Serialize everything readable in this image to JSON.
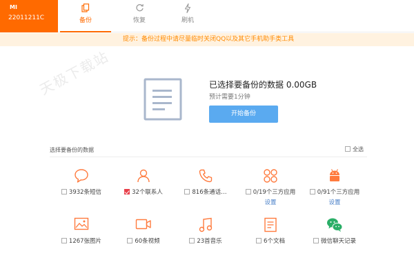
{
  "device": {
    "logo": "MI",
    "model": "22011211C"
  },
  "tabs": [
    {
      "label": "备份",
      "icon": "backup-icon",
      "active": true
    },
    {
      "label": "恢复",
      "icon": "restore-icon",
      "active": false
    },
    {
      "label": "刷机",
      "icon": "flash-icon",
      "active": false
    }
  ],
  "tip": "提示：备份过程中请尽量临时关闭QQ以及其它手机助手类工具",
  "watermark": "天极下载站",
  "summary": {
    "title": "已选择要备份的数据 0.00GB",
    "subtitle": "预计需要1分钟",
    "start_button": "开始备份"
  },
  "section_label": "选择要备份的数据",
  "select_all": "全选",
  "items": [
    {
      "icon": "sms-icon",
      "label": "3932条短信",
      "checked": false
    },
    {
      "icon": "contacts-icon",
      "label": "32个联系人",
      "checked": true
    },
    {
      "icon": "call-log-icon",
      "label": "816条通话…",
      "checked": false
    },
    {
      "icon": "apps-icon",
      "label": "0/19个三方应用",
      "checked": false,
      "link": "设置"
    },
    {
      "icon": "android-icon",
      "label": "0/91个三方应用",
      "checked": false,
      "link": "设置"
    },
    {
      "icon": "photo-icon",
      "label": "1267张图片",
      "checked": false
    },
    {
      "icon": "video-icon",
      "label": "60条视频",
      "checked": false
    },
    {
      "icon": "music-icon",
      "label": "23首音乐",
      "checked": false
    },
    {
      "icon": "document-icon",
      "label": "6个文档",
      "checked": false
    },
    {
      "icon": "wechat-icon",
      "label": "微信聊天记录",
      "checked": false
    }
  ],
  "colors": {
    "accent": "#ff6a00",
    "button": "#5aaaf0",
    "tip_bg": "#fff2e0",
    "wechat": "#2aae67"
  }
}
